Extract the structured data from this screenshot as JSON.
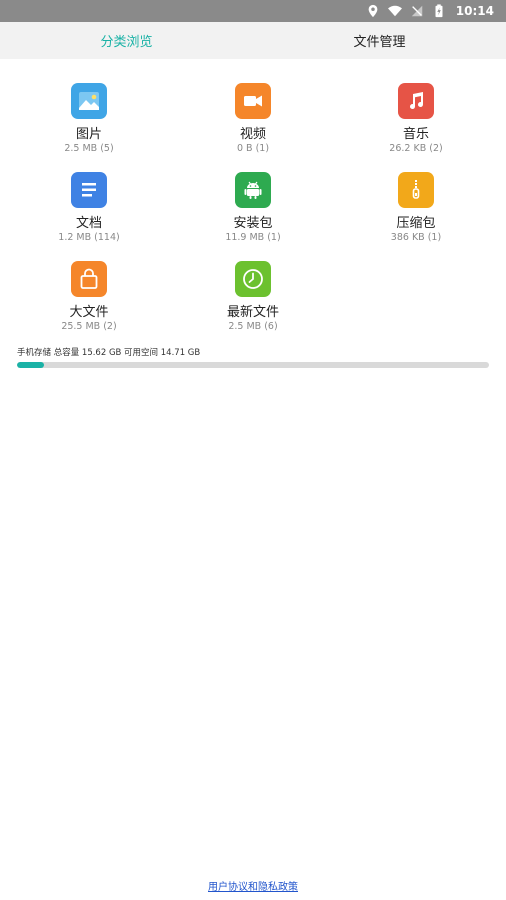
{
  "status_bar": {
    "time": "10:14",
    "icons": [
      "location-icon",
      "wifi-icon",
      "no-signal-icon",
      "battery-charging-icon"
    ]
  },
  "tabs": [
    {
      "label": "分类浏览",
      "active": true
    },
    {
      "label": "文件管理",
      "active": false
    }
  ],
  "categories": [
    {
      "name": "图片",
      "size": "2.5 MB (5)",
      "icon": "image-icon",
      "color": "#3fa5e6"
    },
    {
      "name": "视频",
      "size": "0 B (1)",
      "icon": "video-camera-icon",
      "color": "#f5862a"
    },
    {
      "name": "音乐",
      "size": "26.2 KB (2)",
      "icon": "music-note-icon",
      "color": "#e65446"
    },
    {
      "name": "文档",
      "size": "1.2 MB (114)",
      "icon": "document-icon",
      "color": "#3f82e4"
    },
    {
      "name": "安装包",
      "size": "11.9 MB (1)",
      "icon": "android-icon",
      "color": "#2eaa50"
    },
    {
      "name": "压缩包",
      "size": "386 KB (1)",
      "icon": "zip-icon",
      "color": "#f2a81a"
    },
    {
      "name": "大文件",
      "size": "25.5 MB (2)",
      "icon": "shopping-bag-icon",
      "color": "#f5862a"
    },
    {
      "name": "最新文件",
      "size": "2.5 MB (6)",
      "icon": "clock-icon",
      "color": "#6cc12f"
    }
  ],
  "storage": {
    "label": "手机存储  总容量 15.62 GB  可用空间 14.71 GB",
    "used_fraction": 0.058
  },
  "footer": {
    "link_text": "用户协议和隐私政策"
  },
  "colors": {
    "accent": "#1ab2a6",
    "status_bar": "#8a8a8a",
    "tab_bar": "#f2f2f2",
    "inactive_tab_text": "#222222"
  }
}
